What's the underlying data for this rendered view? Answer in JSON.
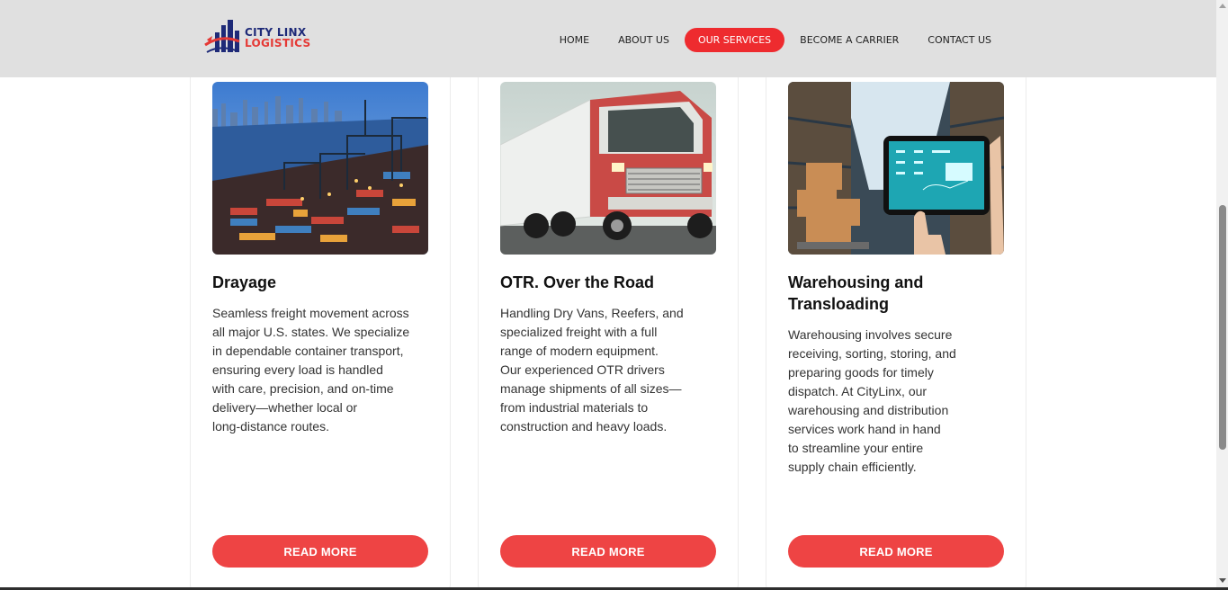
{
  "brand": {
    "line1": "CITY LINX",
    "line2": "LOGISTICS"
  },
  "nav": [
    {
      "label": "HOME",
      "active": false
    },
    {
      "label": "ABOUT US",
      "active": false
    },
    {
      "label": "OUR SERVICES",
      "active": true
    },
    {
      "label": "BECOME A CARRIER",
      "active": false
    },
    {
      "label": "CONTACT US",
      "active": false
    }
  ],
  "services": [
    {
      "title": "Drayage",
      "image": "container-port-image",
      "lines": [
        "Seamless freight movement across",
        "all major U.S. states. We specialize",
        "in dependable container transport,",
        "ensuring every load is handled",
        "with care, precision, and on-time",
        "delivery—whether local or",
        "long-distance routes."
      ],
      "button": "READ MORE"
    },
    {
      "title": "OTR. Over the Road",
      "image": "semi-truck-image",
      "lines": [
        "Handling Dry Vans, Reefers, and",
        "specialized freight with a full",
        "range of modern equipment.",
        "Our experienced OTR drivers",
        "manage shipments of all sizes—",
        "from industrial materials to",
        "construction and heavy loads."
      ],
      "button": "READ MORE"
    },
    {
      "title": "Warehousing and Transloading",
      "image": "warehouse-tablet-image",
      "lines": [
        "Warehousing involves secure",
        "receiving, sorting, storing, and",
        "preparing goods for timely",
        "dispatch. At CityLinx, our",
        "warehousing and distribution",
        "services work hand in hand",
        "to streamline your entire",
        "supply chain efficiently."
      ],
      "button": "READ MORE"
    }
  ],
  "colors": {
    "accent": "#ee4444",
    "nav_active": "#ee2b2f",
    "header_bg": "#e0e0e0",
    "brand_blue": "#1e2a78"
  }
}
